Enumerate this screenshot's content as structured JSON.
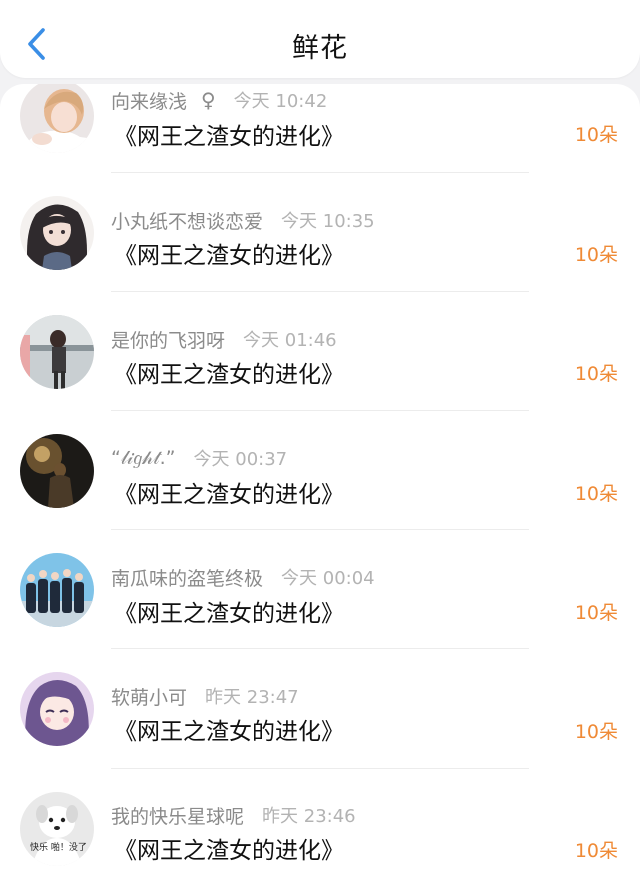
{
  "header": {
    "title": "鲜花",
    "back_icon": "chevron-left-icon",
    "accent": "#3a8ee6"
  },
  "colors": {
    "count": "#ef8a36",
    "username": "#8b8b8b",
    "time": "#b3b3b3"
  },
  "items": [
    {
      "username": "向来缘浅",
      "gender": "♀",
      "time": "今天 10:42",
      "book": "《网王之渣女的进化》",
      "count": "10朵",
      "avatar": "avatar-girl-white"
    },
    {
      "username": "小丸纸不想谈恋爱",
      "gender": "",
      "time": "今天 10:35",
      "book": "《网王之渣女的进化》",
      "count": "10朵",
      "avatar": "avatar-anime-girl"
    },
    {
      "username": "是你的飞羽呀",
      "gender": "",
      "time": "今天 01:46",
      "book": "《网王之渣女的进化》",
      "count": "10朵",
      "avatar": "avatar-photo-girl"
    },
    {
      "username": "“𝓁𝒾𝑔𝒽𝓉.”",
      "gender": "",
      "time": "今天 00:37",
      "book": "《网王之渣女的进化》",
      "count": "10朵",
      "avatar": "avatar-night-silhouette"
    },
    {
      "username": "南瓜味的盗笔终极",
      "gender": "",
      "time": "今天 00:04",
      "book": "《网王之渣女的进化》",
      "count": "10朵",
      "avatar": "avatar-group-photo"
    },
    {
      "username": "软萌小可",
      "gender": "",
      "time": "昨天 23:47",
      "book": "《网王之渣女的进化》",
      "count": "10朵",
      "avatar": "avatar-anime-purple"
    },
    {
      "username": "我的快乐星球呢",
      "gender": "",
      "time": "昨天 23:46",
      "book": "《网王之渣女的进化》",
      "count": "10朵",
      "avatar": "avatar-dog-meme",
      "avatar_text": "快乐 啪！没了"
    }
  ]
}
